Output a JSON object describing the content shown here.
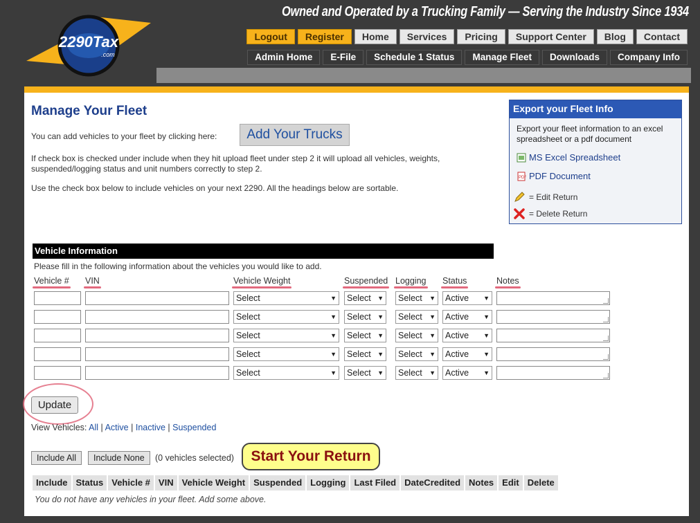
{
  "header": {
    "tagline": "Owned and Operated by a Trucking Family — Serving the Industry Since 1934",
    "logo_text": "2290Tax",
    "logo_sub": ".com"
  },
  "nav_main": [
    "Logout",
    "Register",
    "Home",
    "Services",
    "Pricing",
    "Support Center",
    "Blog",
    "Contact"
  ],
  "nav_admin": [
    "Admin Home",
    "E-File",
    "Schedule 1 Status",
    "Manage Fleet",
    "Downloads",
    "Company Info"
  ],
  "page": {
    "title": "Manage Your Fleet",
    "add_intro": "You can add vehicles to your fleet by clicking here:",
    "add_button": "Add Your Trucks",
    "note1": "If check box is checked under include when they hit upload fleet under step 2 it will upload all vehicles, weights, suspended/logging status and unit numbers correctly to step 2.",
    "note2": "Use the check box below to include vehicles on your next 2290. All the headings below are sortable."
  },
  "export": {
    "title": "Export your Fleet Info",
    "description": "Export your fleet information to an excel spreadsheet or a pdf document",
    "excel_link": "MS Excel Spreadsheet",
    "pdf_link": "PDF Document",
    "edit_legend": "= Edit Return",
    "delete_legend": "= Delete Return"
  },
  "vehicle_info": {
    "header": "Vehicle Information",
    "description": "Please fill in the following information about the vehicles you would like to add.",
    "columns": [
      "Vehicle #",
      "VIN",
      "Vehicle Weight",
      "Suspended",
      "Logging",
      "Status",
      "Notes"
    ],
    "weight_default": "Select",
    "suspended_default": "Select",
    "logging_default": "Select",
    "status_default": "Active"
  },
  "update_button": "Update",
  "view": {
    "label": "View Vehicles:",
    "all": "All",
    "active": "Active",
    "inactive": "Inactive",
    "suspended": "Suspended"
  },
  "include_all": "Include All",
  "include_none": "Include None",
  "vehicles_selected": "(0 vehicles selected)",
  "start_return": "Start Your Return",
  "fleet_table": {
    "headers": [
      "Include",
      "Status",
      "Vehicle #",
      "VIN",
      "Vehicle Weight",
      "Suspended",
      "Logging",
      "Last Filed",
      "DateCredited",
      "Notes",
      "Edit",
      "Delete"
    ],
    "empty_message": "You do not have any vehicles in your fleet. Add some above."
  },
  "colors": {
    "accent_orange": "#f7b21b",
    "title_blue": "#1e3f8c",
    "start_yellow": "#fefe8c"
  }
}
